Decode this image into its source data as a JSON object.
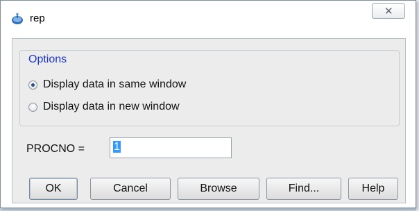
{
  "window": {
    "title": "rep",
    "icon": "bruker-app-icon",
    "close_glyph": "ΣΖ"
  },
  "options": {
    "group_title": "Options",
    "radios": [
      {
        "label": "Display data in same window",
        "checked": true
      },
      {
        "label": "Display data in new window",
        "checked": false
      }
    ]
  },
  "procno": {
    "label": "PROCNO =",
    "value": "1"
  },
  "buttons": {
    "ok": "OK",
    "cancel": "Cancel",
    "browse": "Browse",
    "find": "Find...",
    "help": "Help"
  },
  "colors": {
    "group_title": "#1c38c8",
    "selection": "#3399ff"
  }
}
